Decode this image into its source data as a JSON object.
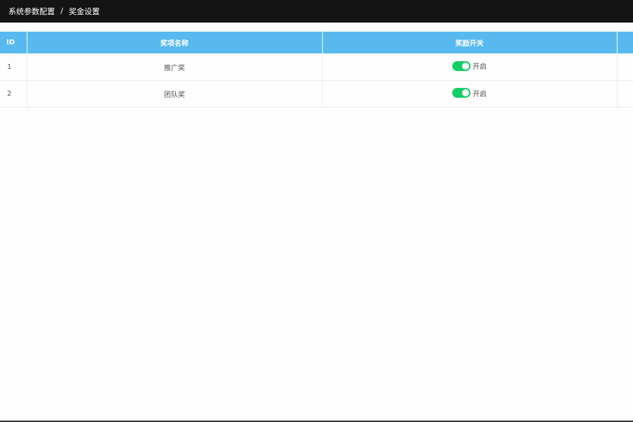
{
  "breadcrumb": {
    "items": [
      "系统参数配置",
      "奖金设置"
    ],
    "separator": "/"
  },
  "table": {
    "columns": [
      "ID",
      "奖项名称",
      "奖励开关",
      ""
    ],
    "rows": [
      {
        "id": "1",
        "name": "推广奖",
        "switch_label": "开启",
        "switch_on": true
      },
      {
        "id": "2",
        "name": "团队奖",
        "switch_label": "开启",
        "switch_on": true
      }
    ]
  },
  "colors": {
    "header_bg": "#57b9ef",
    "topbar_bg": "#141414",
    "switch_on": "#13ce66"
  },
  "icons": {
    "toggle": "toggle-switch-icon"
  }
}
